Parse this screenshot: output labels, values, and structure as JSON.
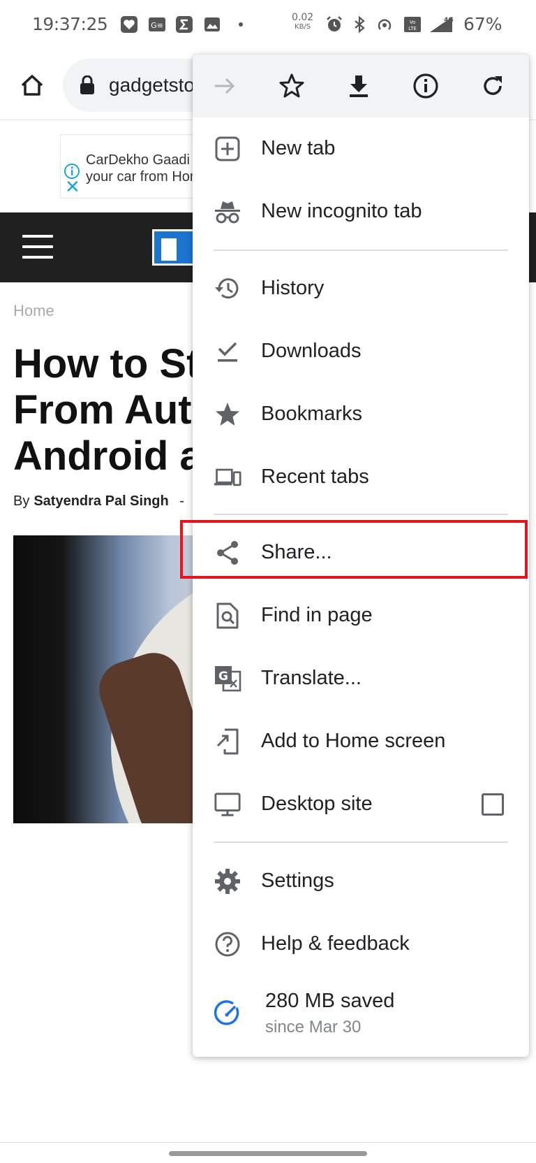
{
  "status_bar": {
    "time": "19:37:25",
    "net_speed_value": "0.02",
    "net_speed_unit": "KB/S",
    "battery": "67%",
    "icons": [
      "heart-app-icon",
      "gmail-icon",
      "sigma-icon",
      "image-icon",
      "dot-icon",
      "alarm-icon",
      "bluetooth-icon",
      "hotspot-icon",
      "volte-icon",
      "signal-4g-icon"
    ]
  },
  "toolbar": {
    "url": "gadgetstouse.com",
    "icons": [
      "home-icon",
      "lock-icon"
    ]
  },
  "ad": {
    "line1": "CarDekho Gaadi Store: Sell",
    "line2": "your car from Home"
  },
  "article": {
    "breadcrumb": "Home",
    "title": "How to Stop Apps\nFrom Auto-Starting on\nAndroid and iPhone",
    "by": "By",
    "author": "Satyendra Pal Singh",
    "byline_sep": "-"
  },
  "menu": {
    "top_icons": [
      "forward-icon",
      "star-icon",
      "download-icon",
      "info-icon",
      "refresh-icon"
    ],
    "items": [
      {
        "label": "New tab",
        "icon": "new-tab-icon"
      },
      {
        "label": "New incognito tab",
        "icon": "incognito-icon"
      },
      {
        "label": "History",
        "icon": "history-icon"
      },
      {
        "label": "Downloads",
        "icon": "downloads-icon"
      },
      {
        "label": "Bookmarks",
        "icon": "bookmarks-icon"
      },
      {
        "label": "Recent tabs",
        "icon": "recent-tabs-icon"
      },
      {
        "label": "Share...",
        "icon": "share-icon"
      },
      {
        "label": "Find in page",
        "icon": "find-in-page-icon"
      },
      {
        "label": "Translate...",
        "icon": "translate-icon"
      },
      {
        "label": "Add to Home screen",
        "icon": "add-to-home-icon"
      },
      {
        "label": "Desktop site",
        "icon": "desktop-icon",
        "checked": false
      },
      {
        "label": "Settings",
        "icon": "settings-icon"
      },
      {
        "label": "Help & feedback",
        "icon": "help-icon"
      }
    ],
    "data_saved": {
      "amount": "280 MB saved",
      "since": "since Mar 30"
    },
    "highlight_color": "#e8141c"
  }
}
